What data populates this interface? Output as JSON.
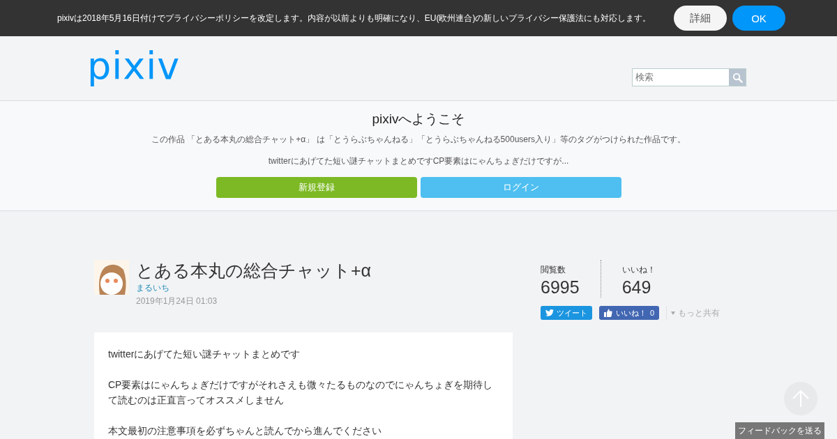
{
  "consent_bar": {
    "message": "pixivは2018年5月16日付けでプライバシーポリシーを改定します。内容が以前よりも明確になり、EU(欧州連合)の新しいプライバシー保護法にも対応します。",
    "buttons": [
      {
        "label": "詳細",
        "kind": "secondary"
      },
      {
        "label": "OK",
        "kind": "primary"
      }
    ]
  },
  "header": {
    "logo": "pixiv",
    "search": {
      "placeholder": "検索"
    }
  },
  "welcome": {
    "title": "pixivへようこそ",
    "description": "この作品 「とある本丸の総合チャット+α」 は「とうらぶちゃんねる」「とうらぶちゃんねる500users入り」等のタグがつけられた作品です。",
    "excerpt": "twitterにあげてた短い謎チャットまとめですCP要素はにゃんちょぎだけですが...",
    "buttons": [
      {
        "label": "新規登録",
        "kind": "signup"
      },
      {
        "label": "ログイン",
        "kind": "login"
      }
    ]
  },
  "work": {
    "title": "とある本丸の総合チャット+α",
    "author": "まるいち",
    "date": "2019年1月24日 01:03",
    "paragraphs": [
      "twitterにあげてた短い謎チャットまとめです",
      "CP要素はにゃんちょぎだけですがそれさえも微々たるものなのでにゃんちょぎを期待して読むのは正直言ってオススメしません",
      "本文最初の注意事項を必ずちゃんと読んでから進んでください"
    ]
  },
  "stats": [
    {
      "label": "閲覧数",
      "value": "6995"
    },
    {
      "label": "いいね！",
      "value": "649"
    }
  ],
  "share": {
    "tweet": "ツイート",
    "like": "いいね！",
    "like_count": "0",
    "more": "もっと共有"
  },
  "feedback_button": "フィードバックを送る"
}
